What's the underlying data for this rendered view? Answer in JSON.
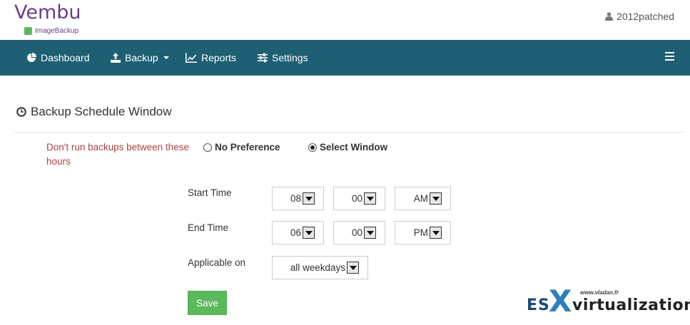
{
  "brand": {
    "name": "Vembu",
    "product": "ImageBackup"
  },
  "header": {
    "user": "2012patched",
    "user_icon": "user-icon"
  },
  "nav": {
    "items": [
      {
        "label": "Dashboard",
        "icon": "pie-chart-icon"
      },
      {
        "label": "Backup",
        "icon": "upload-icon"
      },
      {
        "label": "Reports",
        "icon": "line-chart-icon"
      },
      {
        "label": "Settings",
        "icon": "sliders-icon"
      }
    ],
    "menu_icon": "hamburger-icon"
  },
  "page": {
    "title": "Backup Schedule Window",
    "title_icon": "clock-icon"
  },
  "form": {
    "note": "Don't run backups between these hours",
    "options": [
      {
        "label": "No Preference",
        "checked": false
      },
      {
        "label": "Select Window",
        "checked": true
      }
    ],
    "start_time": {
      "label": "Start Time",
      "hour": "08",
      "minute": "00",
      "period": "AM"
    },
    "end_time": {
      "label": "End Time",
      "hour": "06",
      "minute": "00",
      "period": "PM"
    },
    "applicable": {
      "label": "Applicable on",
      "value": "all weekdays"
    },
    "save_label": "Save"
  },
  "watermark": {
    "site": "www.vladan.fr",
    "es": "ES",
    "x": "X",
    "rest": "virtualization"
  },
  "colors": {
    "navbar": "#1e5f74",
    "save": "#5cb85c",
    "note": "#a94442",
    "brand": "#6a3d8c"
  }
}
